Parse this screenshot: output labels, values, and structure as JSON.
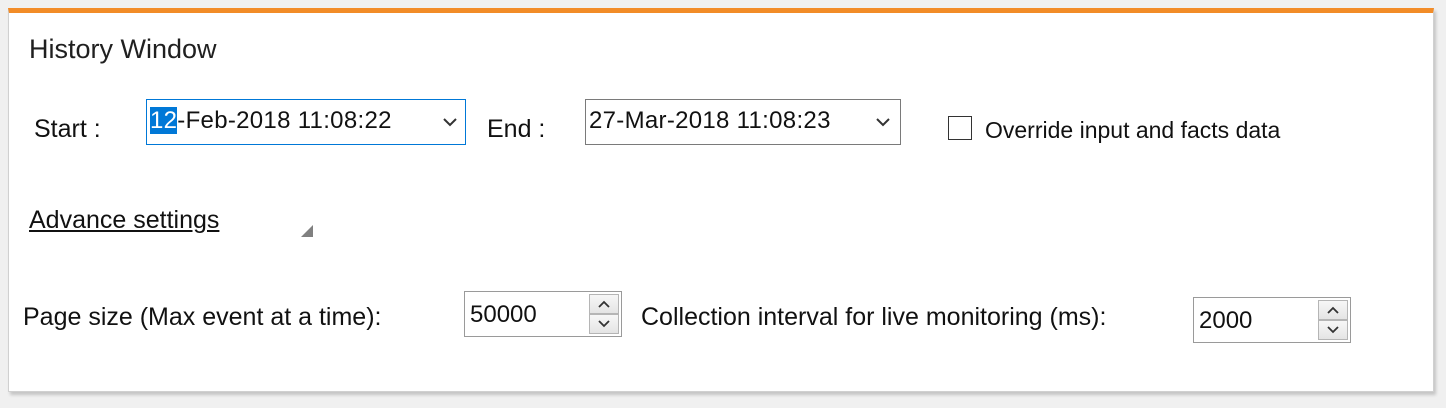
{
  "window": {
    "title": "History Window"
  },
  "range": {
    "start_label": "Start :",
    "start_selected_part": "12",
    "start_rest": "-Feb-2018 11:08:22",
    "end_label": "End :",
    "end_value": "27-Mar-2018 11:08:23"
  },
  "override": {
    "label": "Override input and facts data",
    "checked": false
  },
  "advanced": {
    "link_label": "Advance settings"
  },
  "paging": {
    "page_size_label": "Page size (Max event at a time):",
    "page_size_value": "50000",
    "interval_label": "Collection interval for live monitoring (ms):",
    "interval_value": "2000"
  },
  "colors": {
    "accent_bar": "#f28c28",
    "focus": "#0078d7"
  },
  "icons": {
    "dropdown": "chevron-down-icon",
    "spin_up": "arrow-up-icon",
    "spin_down": "arrow-down-icon",
    "expander": "triangle-expander-icon"
  }
}
